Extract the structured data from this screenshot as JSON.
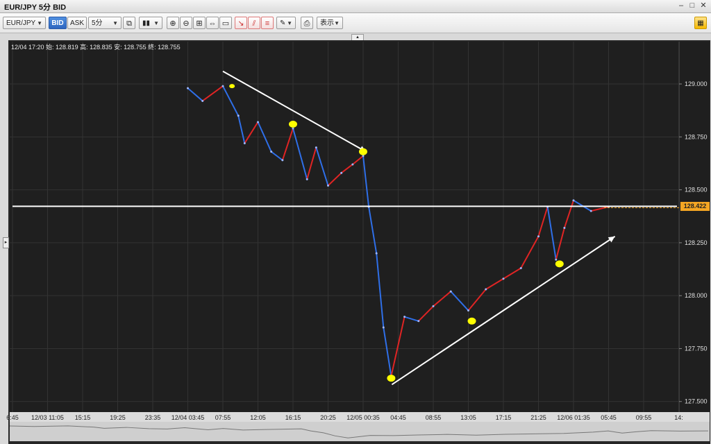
{
  "window": {
    "title": "EUR/JPY 5分 BID",
    "minimize_icon": "minimize-icon",
    "restore_icon": "restore-icon",
    "close_icon": "close-icon"
  },
  "toolbar": {
    "symbol": "EUR/JPY",
    "bid_label": "BID",
    "ask_label": "ASK",
    "timeframe": "5分",
    "display_label": "表示",
    "icons": [
      "link-icon",
      "candle-type-icon",
      "zoom-in-icon",
      "zoom-out-icon",
      "fit-icon",
      "expand-icon",
      "window-icon",
      "draw-line-icon",
      "draw-channel-icon",
      "draw-fib-icon",
      "pen-icon",
      "screenshot-icon",
      "layout-icon"
    ]
  },
  "ohlc_text": "12/04 17:20  始: 128.819  高: 128.835  安: 128.755  終: 128.755",
  "current_price_label": "128.422",
  "colors": {
    "background": "#1f1f1f",
    "up": "#e02424",
    "down": "#2f6fe8",
    "price_tag": "#f5a623",
    "annotation": "#ffffff",
    "marker": "#ffff00"
  },
  "chart_data": {
    "type": "line",
    "title": "EUR/JPY 5分 BID",
    "series": [
      {
        "name": "",
        "values": [
          {
            "x": "12/04 03:45",
            "y": 128.98
          },
          {
            "x": "12/04 05:30",
            "y": 128.92
          },
          {
            "x": "12/04 07:55",
            "y": 128.99
          },
          {
            "x": "12/04 09:45",
            "y": 128.85
          },
          {
            "x": "12/04 10:30",
            "y": 128.72
          },
          {
            "x": "12/04 12:05",
            "y": 128.82
          },
          {
            "x": "12/04 13:40",
            "y": 128.68
          },
          {
            "x": "12/04 15:00",
            "y": 128.64
          },
          {
            "x": "12/04 16:15",
            "y": 128.79
          },
          {
            "x": "12/04 17:55",
            "y": 128.55
          },
          {
            "x": "12/04 19:00",
            "y": 128.7
          },
          {
            "x": "12/04 20:25",
            "y": 128.52
          },
          {
            "x": "12/04 22:00",
            "y": 128.58
          },
          {
            "x": "12/04 23:20",
            "y": 128.62
          },
          {
            "x": "12/05 00:35",
            "y": 128.66
          },
          {
            "x": "12/05 01:15",
            "y": 128.42
          },
          {
            "x": "12/05 02:10",
            "y": 128.2
          },
          {
            "x": "12/05 03:00",
            "y": 127.85
          },
          {
            "x": "12/05 03:55",
            "y": 127.62
          },
          {
            "x": "12/05 05:30",
            "y": 127.9
          },
          {
            "x": "12/05 07:10",
            "y": 127.88
          },
          {
            "x": "12/05 08:55",
            "y": 127.95
          },
          {
            "x": "12/05 11:00",
            "y": 128.02
          },
          {
            "x": "12/05 13:05",
            "y": 127.93
          },
          {
            "x": "12/05 15:10",
            "y": 128.03
          },
          {
            "x": "12/05 17:15",
            "y": 128.08
          },
          {
            "x": "12/05 19:20",
            "y": 128.13
          },
          {
            "x": "12/05 21:25",
            "y": 128.28
          },
          {
            "x": "12/05 22:30",
            "y": 128.42
          },
          {
            "x": "12/05 23:30",
            "y": 128.17
          },
          {
            "x": "12/06 00:30",
            "y": 128.32
          },
          {
            "x": "12/06 01:35",
            "y": 128.45
          },
          {
            "x": "12/06 03:40",
            "y": 128.4
          },
          {
            "x": "12/06 05:45",
            "y": 128.42
          }
        ]
      }
    ],
    "y_ticks": [
      "129.000",
      "128.750",
      "128.500",
      "128.250",
      "128.000",
      "127.750",
      "127.500"
    ],
    "x_ticks": [
      "6:45",
      "12/03 11:05",
      "15:15",
      "19:25",
      "23:35",
      "12/04 03:45",
      "07:55",
      "12:05",
      "16:15",
      "20:25",
      "12/05 00:35",
      "04:45",
      "08:55",
      "13:05",
      "17:15",
      "21:25",
      "12/06 01:35",
      "05:45",
      "09:55",
      "14:"
    ],
    "ylim": [
      127.45,
      129.2
    ],
    "horizontal_line": 128.422,
    "trend_lines": [
      {
        "from": {
          "x": "12/04 07:55",
          "y": 129.06
        },
        "to": {
          "x": "12/05 00:55",
          "y": 128.68
        }
      },
      {
        "from": {
          "x": "12/05 04:00",
          "y": 127.58
        },
        "to": {
          "x": "12/06 06:30",
          "y": 128.28
        }
      }
    ],
    "markers": [
      {
        "x": "12/04 09:00",
        "y": 128.99
      },
      {
        "x": "12/04 16:15",
        "y": 128.81
      },
      {
        "x": "12/05 00:35",
        "y": 128.68
      },
      {
        "x": "12/05 03:55",
        "y": 127.61
      },
      {
        "x": "12/05 13:30",
        "y": 127.88
      },
      {
        "x": "12/05 23:55",
        "y": 128.15
      }
    ],
    "grid": true
  }
}
